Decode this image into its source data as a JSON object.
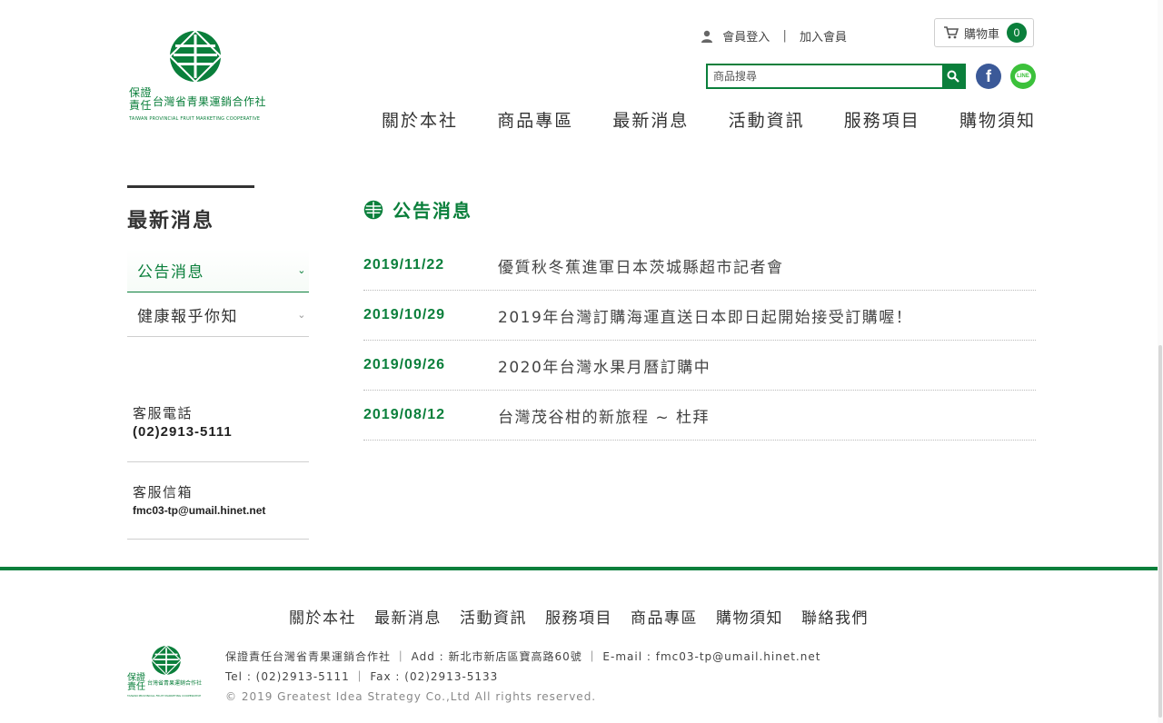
{
  "brand": {
    "logo_cn_line1": "保證",
    "logo_cn_line2": "責任",
    "logo_cn_name": "台灣省青果運銷合作社",
    "logo_en": "TAIWAN PROVINCIAL FRUIT MARKETING COOPERATIVE"
  },
  "header": {
    "login_label": "會員登入",
    "divider": "|",
    "join_label": "加入會員",
    "cart_label": "購物車",
    "cart_count": "0",
    "search_placeholder": "商品搜尋",
    "facebook_icon": "f",
    "line_icon": "LINE"
  },
  "nav": {
    "items": [
      "關於本社",
      "商品專區",
      "最新消息",
      "活動資訊",
      "服務項目",
      "購物須知"
    ]
  },
  "sidebar": {
    "title": "最新消息",
    "items": [
      {
        "label": "公告消息",
        "active": true
      },
      {
        "label": "健康報乎你知",
        "active": false
      }
    ],
    "phone_label": "客服電話",
    "phone_value": "(02)2913-5111",
    "email_label": "客服信箱",
    "email_value": "fmc03-tp@umail.hinet.net"
  },
  "content": {
    "section_title": "公告消息",
    "news": [
      {
        "date": "2019/11/22",
        "title": "優質秋冬蕉進軍日本茨城縣超市記者會"
      },
      {
        "date": "2019/10/29",
        "title": "2019年台灣訂購海運直送日本即日起開始接受訂購喔！"
      },
      {
        "date": "2019/09/26",
        "title": "2020年台灣水果月曆訂購中"
      },
      {
        "date": "2019/08/12",
        "title": "台灣茂谷柑的新旅程 ~ 杜拜"
      }
    ]
  },
  "footer": {
    "nav": [
      "關於本社",
      "最新消息",
      "活動資訊",
      "服務項目",
      "商品專區",
      "購物須知",
      "聯絡我們"
    ],
    "line1": "保證責任台灣省青果運銷合作社 ｜ Add : 新北市新店區寶高路60號 ｜ E-mail : fmc03-tp@umail.hinet.net",
    "line2": "Tel : (02)2913-5111 ｜ Fax : (02)2913-5133",
    "copyright": "© 2019 Greatest Idea Strategy Co.,Ltd All rights reserved."
  },
  "colors": {
    "brand_green": "#0a7f3b",
    "facebook_blue": "#3b5998",
    "line_green": "#3cc13b"
  }
}
